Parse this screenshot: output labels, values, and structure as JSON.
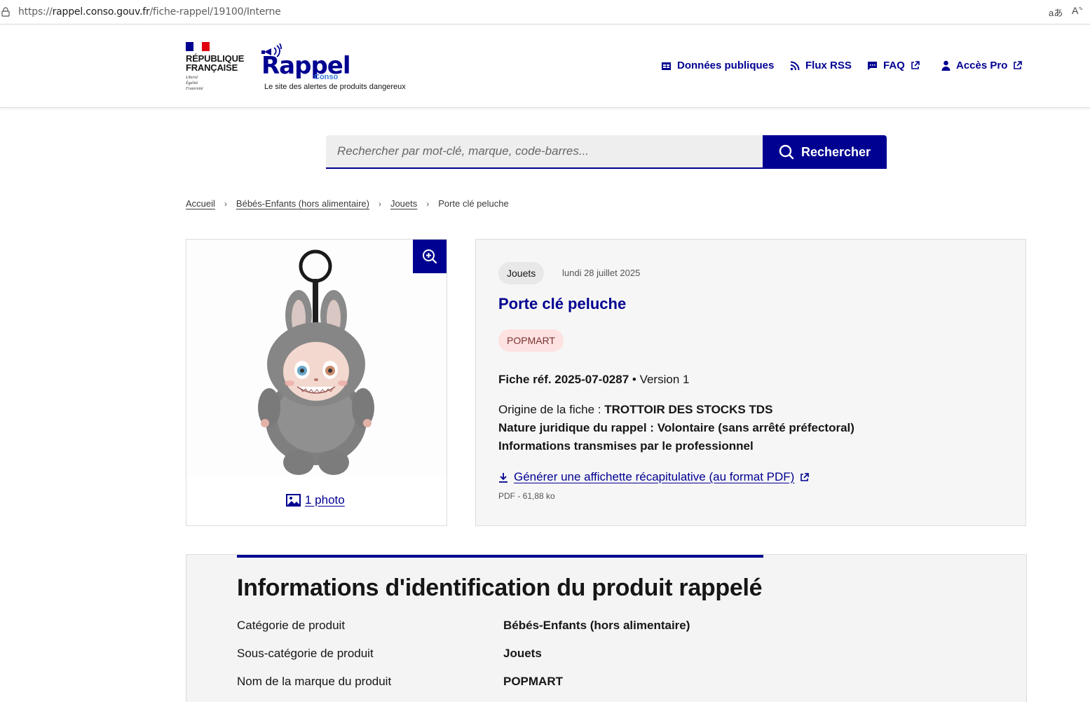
{
  "browser": {
    "url_prefix": "https://",
    "url_host": "rappel.conso.gouv.fr",
    "url_path": "/fiche-rappel/19100/Interne"
  },
  "header": {
    "republic_line1": "RÉPUBLIQUE",
    "republic_line2": "FRANÇAISE",
    "motto1": "Liberté",
    "motto2": "Égalité",
    "motto3": "Fraternité",
    "logo_word": "Rappel",
    "logo_sub": "Conso",
    "tagline": "Le site des alertes de produits dangereux",
    "nav": [
      {
        "label": "Données publiques",
        "icon": "data-table-icon"
      },
      {
        "label": "Flux RSS",
        "icon": "rss-icon"
      },
      {
        "label": "FAQ",
        "icon": "chat-icon"
      },
      {
        "label": "Accès Pro",
        "icon": "user-icon"
      }
    ]
  },
  "search": {
    "placeholder": "Rechercher par mot-clé, marque, code-barres...",
    "button_label": "Rechercher"
  },
  "breadcrumb": [
    "Accueil",
    "Bébés-Enfants (hors alimentaire)",
    "Jouets",
    "Porte clé peluche"
  ],
  "photo": {
    "count_label": "1 photo"
  },
  "product": {
    "category_tag": "Jouets",
    "date": "lundi 28 juillet 2025",
    "title": "Porte clé peluche",
    "brand": "POPMART",
    "ref_label": "Fiche réf. 2025-07-0287",
    "ref_sep": " • ",
    "version": "Version 1",
    "origin_label": "Origine de la fiche : ",
    "origin_value": "TROTTOIR DES STOCKS TDS",
    "nature_label": "Nature juridique du rappel :  ",
    "nature_value": "Volontaire (sans arrêté préfectoral)",
    "info_line": "Informations transmises par le professionnel",
    "pdf_link": "Générer une affichette récapitulative (au format PDF)",
    "pdf_meta": "PDF - 61,88 ko"
  },
  "identification": {
    "title": "Informations d'identification du produit rappelé",
    "rows": [
      {
        "label": "Catégorie de produit",
        "value": "Bébés-Enfants (hors alimentaire)"
      },
      {
        "label": "Sous-catégorie de produit",
        "value": "Jouets"
      },
      {
        "label": "Nom de la marque du produit",
        "value": "POPMART"
      }
    ]
  },
  "colors": {
    "primary": "#000091",
    "badge_bg": "#fde2e1",
    "flag_blue": "#000091",
    "flag_red": "#e1000f"
  }
}
